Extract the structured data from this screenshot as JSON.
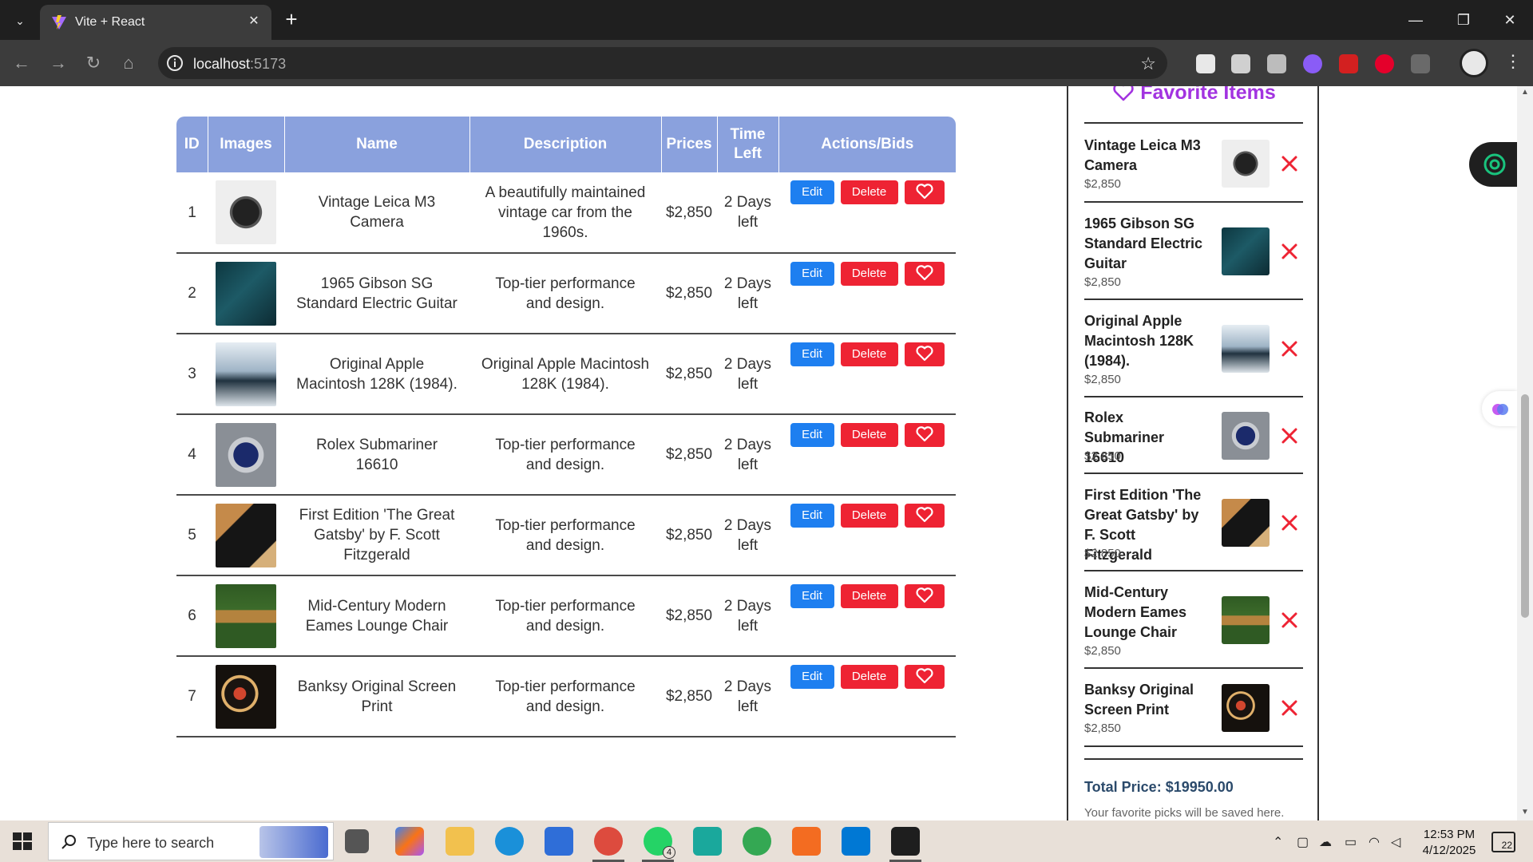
{
  "browser": {
    "tab_title": "Vite + React",
    "tab_close": "✕",
    "new_tab": "+",
    "url_host": "localhost",
    "url_port": ":5173",
    "window_controls": {
      "minimize": "—",
      "maximize": "❐",
      "close": "✕"
    }
  },
  "table": {
    "headers": [
      "ID",
      "Images",
      "Name",
      "Description",
      "Prices",
      "Time Left",
      "Actions/Bids"
    ],
    "buttons": {
      "edit": "Edit",
      "delete": "Delete"
    },
    "rows": [
      {
        "id": "1",
        "name": "Vintage Leica M3 Camera",
        "description": "A beautifully maintained vintage car from the 1960s.",
        "price": "$2,850",
        "time_left": "2 Days left",
        "image": "camera-photo"
      },
      {
        "id": "2",
        "name": "1965 Gibson SG Standard Electric Guitar",
        "description": "Top-tier performance and design.",
        "price": "$2,850",
        "time_left": "2 Days left",
        "image": "guitar-photo"
      },
      {
        "id": "3",
        "name": "Original Apple Macintosh 128K (1984).",
        "description": "Original Apple Macintosh 128K (1984).",
        "price": "$2,850",
        "time_left": "2 Days left",
        "image": "laptop-photo"
      },
      {
        "id": "4",
        "name": "Rolex Submariner 16610",
        "description": "Top-tier performance and design.",
        "price": "$2,850",
        "time_left": "2 Days left",
        "image": "watch-photo"
      },
      {
        "id": "5",
        "name": "First Edition 'The Great Gatsby' by F. Scott Fitzgerald",
        "description": "Top-tier performance and design.",
        "price": "$2,850",
        "time_left": "2 Days left",
        "image": "book-photo"
      },
      {
        "id": "6",
        "name": "Mid-Century Modern Eames Lounge Chair",
        "description": "Top-tier performance and design.",
        "price": "$2,850",
        "time_left": "2 Days left",
        "image": "chair-photo"
      },
      {
        "id": "7",
        "name": "Banksy Original Screen Print",
        "description": "Top-tier performance and design.",
        "price": "$2,850",
        "time_left": "2 Days left",
        "image": "painting-photo"
      }
    ]
  },
  "favorites": {
    "title": "Favorite Items",
    "items": [
      {
        "name": "Vintage Leica M3 Camera",
        "price": "$2,850",
        "image": "camera-photo"
      },
      {
        "name": "1965 Gibson SG Standard Electric Guitar",
        "price": "$2,850",
        "image": "guitar-photo"
      },
      {
        "name": "Original Apple Macintosh 128K (1984).",
        "price": "$2,850",
        "image": "laptop-photo"
      },
      {
        "name": "Rolex Submariner 16610",
        "price": "$2,850",
        "image": "watch-photo"
      },
      {
        "name": "First Edition 'The Great Gatsby' by F. Scott Fitzgerald",
        "price": "$2,850",
        "image": "book-photo"
      },
      {
        "name": "Mid-Century Modern Eames Lounge Chair",
        "price": "$2,850",
        "image": "chair-photo"
      },
      {
        "name": "Banksy Original Screen Print",
        "price": "$2,850",
        "image": "painting-photo"
      }
    ],
    "total": "Total Price: $19950.00",
    "hint": "Your favorite picks will be saved here."
  },
  "taskbar": {
    "search_placeholder": "Type here to search",
    "time": "12:53 PM",
    "date": "4/12/2025",
    "whatsapp_badge": "4",
    "notifications_count": "22"
  },
  "colors": {
    "table_header": "#8aa1dd",
    "edit_button": "#1e7ff0",
    "delete_button": "#ee2333",
    "favorites_title": "#a233e0",
    "remove_x": "#ee2333"
  }
}
